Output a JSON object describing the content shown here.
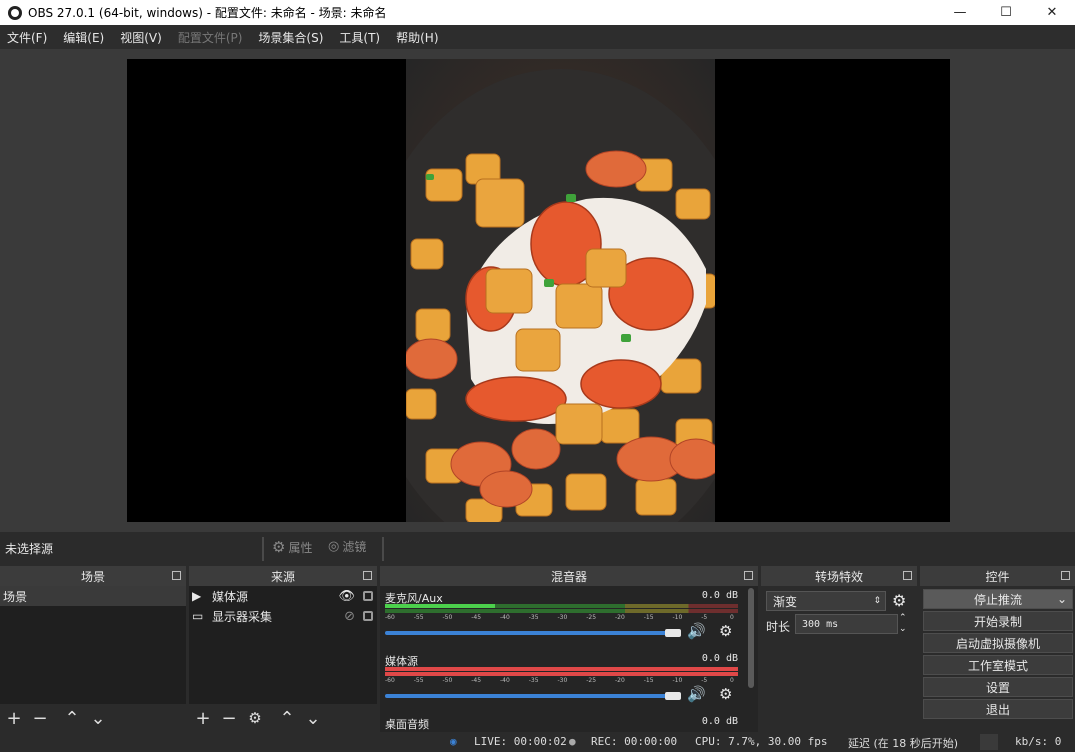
{
  "window": {
    "title": "OBS 27.0.1 (64-bit, windows) - 配置文件: 未命名 - 场景: 未命名",
    "minimize": "—",
    "maximize": "☐",
    "close": "✕"
  },
  "menu": [
    "文件(F)",
    "编辑(E)",
    "视图(V)",
    "配置文件(P)",
    "场景集合(S)",
    "工具(T)",
    "帮助(H)"
  ],
  "source_toolbar": {
    "no_selection": "未选择源",
    "properties": "属性",
    "filters": "滤镜"
  },
  "scenes": {
    "title": "场景",
    "items": [
      "场景"
    ]
  },
  "sources": {
    "title": "来源",
    "items": [
      {
        "label": "媒体源",
        "icon": "play-icon"
      },
      {
        "label": "显示器采集",
        "icon": "monitor-icon"
      }
    ]
  },
  "mixer": {
    "title": "混音器",
    "channels": [
      {
        "name": "麦克风/Aux",
        "db": "0.0 dB"
      },
      {
        "name": "媒体源",
        "db": "0.0 dB"
      },
      {
        "name": "桌面音频",
        "db": "0.0 dB"
      }
    ],
    "scale": [
      "-60",
      "-55",
      "-50",
      "-45",
      "-40",
      "-35",
      "-30",
      "-25",
      "-20",
      "-15",
      "-10",
      "-5",
      "0"
    ]
  },
  "transitions": {
    "title": "转场特效",
    "selected": "渐变",
    "duration_label": "时长",
    "duration_value": "300 ms"
  },
  "controls": {
    "title": "控件",
    "buttons": [
      "停止推流",
      "开始录制",
      "启动虚拟摄像机",
      "工作室模式",
      "设置",
      "退出"
    ]
  },
  "status": {
    "live": "LIVE: 00:00:02",
    "rec": "REC: 00:00:00",
    "cpu": "CPU: 7.7%, 30.00 fps",
    "delay": "延迟 (在 18 秒后开始)",
    "kbps": "kb/s: 0"
  }
}
